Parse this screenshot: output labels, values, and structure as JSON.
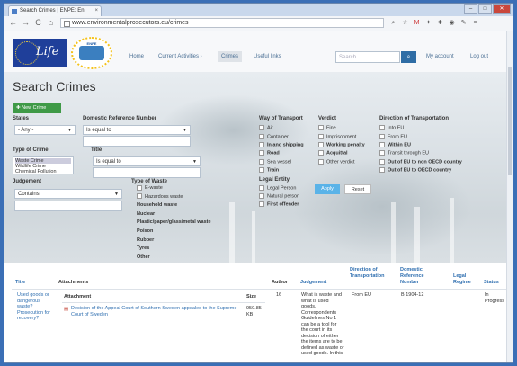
{
  "browser": {
    "tab_title": "Search Crimes | ENPE: En",
    "tab_close": "×",
    "url": "www.environmentalprosecutors.eu/crimes",
    "back": "←",
    "forward": "→",
    "reload": "C",
    "home": "⌂",
    "window_buttons": {
      "minimize": "–",
      "maximize": "□",
      "close": "✕"
    }
  },
  "header": {
    "life_logo_text": "Life",
    "enpe_logo_text": "ENPE",
    "menu": [
      {
        "label": "Home"
      },
      {
        "label": "Current Activities ›"
      },
      {
        "label": "Crimes"
      },
      {
        "label": "Useful links"
      }
    ],
    "search_placeholder": "Search",
    "search_icon": "magnifier",
    "my_account": "My account",
    "logout": "Log out"
  },
  "main": {
    "title": "Search Crimes",
    "new_crime_label": "✚ New Crime",
    "filters": {
      "states_label": "States",
      "states_value": "- Any -",
      "domestic_ref_label": "Domestic Reference Number",
      "domestic_ref_operator": "Is equal to",
      "type_of_crime_label": "Type of Crime",
      "type_of_crime_options": [
        "Waste Crime",
        "Wildlife Crime",
        "Chemical Pollution"
      ],
      "title_label": "Title",
      "title_operator": "Is equal to",
      "judgement_label": "Judgement",
      "judgement_operator": "Contains",
      "type_of_waste_label": "Type of Waste",
      "type_of_waste_options": [
        "E-waste",
        "Hazardous waste",
        "Household waste",
        "Nuclear",
        "Plastic/paper/glass/metal waste",
        "Poison",
        "Rubber",
        "Tyres",
        "Other"
      ],
      "way_of_transport_label": "Way of Transport",
      "way_of_transport_options": [
        "Air",
        "Container",
        "Inland shipping",
        "Road",
        "Sea vessel",
        "Train"
      ],
      "verdict_label": "Verdict",
      "verdict_options": [
        "Fine",
        "Imprisonment",
        "Working penalty",
        "Acquittal",
        "Other verdict"
      ],
      "direction_label": "Direction of Transportation",
      "direction_options": [
        "Into EU",
        "From EU",
        "Within EU",
        "Transit through EU",
        "Out of EU to non OECD country",
        "Out of EU to OECD country"
      ],
      "legal_entity_label": "Legal Entity",
      "legal_entity_options": [
        "Legal Person",
        "Natural person",
        "First offender"
      ],
      "apply_label": "Apply",
      "reset_label": "Reset"
    },
    "results": {
      "columns": [
        "Title",
        "Attachments",
        "Author",
        "Judgement",
        "Direction of Transportation",
        "Domestic Reference Number",
        "Legal Regime",
        "Status"
      ],
      "row": {
        "title": "Used goods or dangerous waste? Prosecution for recovery?",
        "attachment_header": "Attachment",
        "size_header": "Size",
        "attachment_name": "Decision of the Appeal Court of Southern Sweden appealed to the Supreme Court of Sweden",
        "attachment_size": "950.85 KB",
        "author": "16",
        "judgement": "What is waste and what is used goods. Correspondents Guidelines No 1 can be a tool for the court in its decision of either the items are to be defined as waste or used goods. In this",
        "direction": "From EU",
        "domestic_ref": "B 1904-12",
        "legal_regime": "",
        "status": "In Progress"
      }
    }
  }
}
